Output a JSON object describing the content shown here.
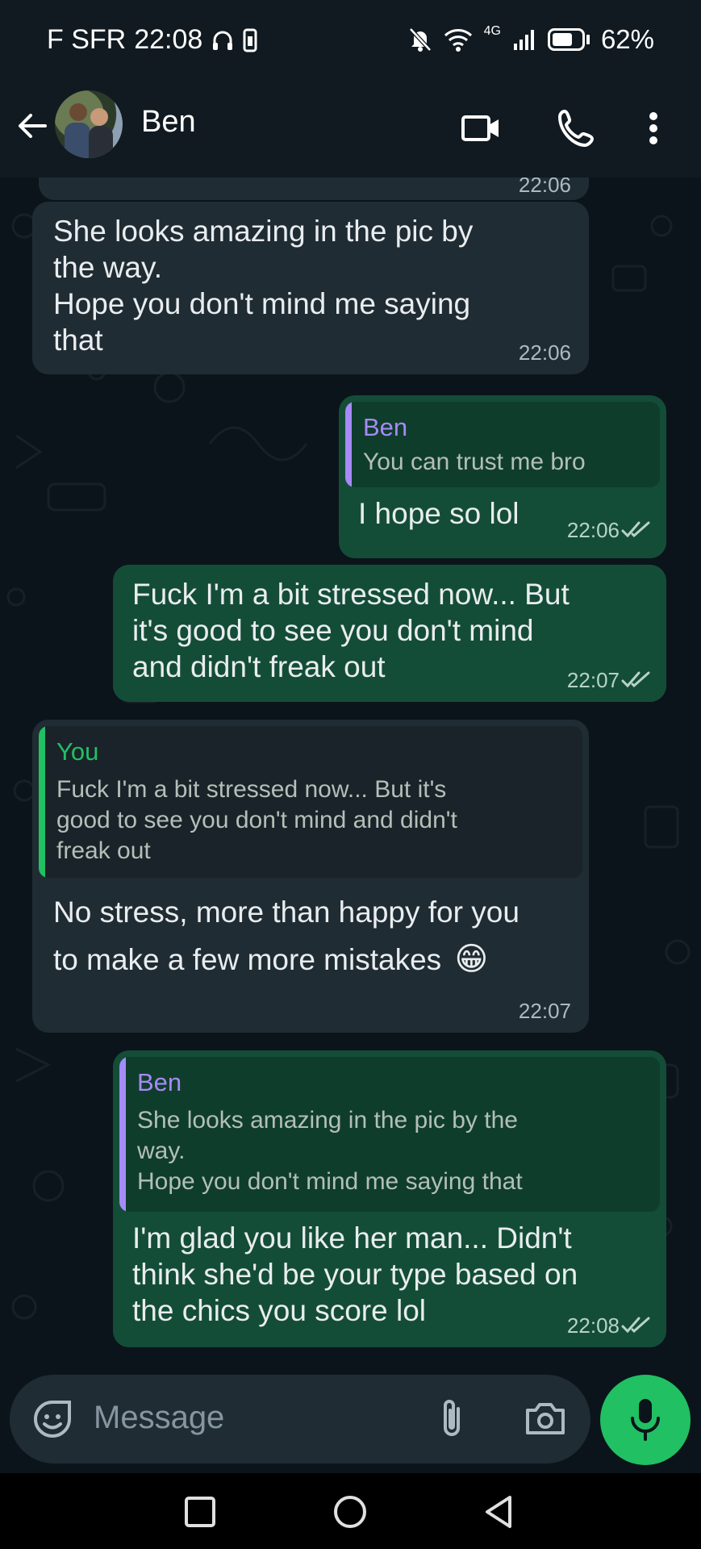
{
  "status_bar": {
    "carrier": "F SFR",
    "time": "22:08",
    "network": "4G",
    "battery": "62%"
  },
  "header": {
    "contact_name": "Ben"
  },
  "messages": [
    {
      "direction": "in",
      "lines": [
        "She looks amazing in the pic by",
        "the way.",
        "Hope you don't mind me saying",
        "that"
      ],
      "time": "22:06"
    },
    {
      "direction": "out",
      "quote_name": "Ben",
      "quote_lines": [
        "You can trust me bro"
      ],
      "lines": [
        "I hope so lol"
      ],
      "time": "22:06"
    },
    {
      "direction": "out",
      "lines": [
        "Fuck I'm a bit stressed now... But",
        "it's good to see you don't mind",
        "and didn't freak out"
      ],
      "time": "22:07"
    },
    {
      "direction": "in",
      "quote_name": "You",
      "quote_lines": [
        "Fuck I'm a bit stressed now... But it's",
        "good to see you don't mind and didn't",
        "freak out"
      ],
      "lines": [
        "No stress, more than happy for you",
        "to make a few more mistakes"
      ],
      "emoji": "😁",
      "time": "22:07"
    },
    {
      "direction": "out",
      "quote_name": "Ben",
      "quote_lines": [
        "She looks amazing in the pic by the",
        "way.",
        "Hope you don't mind me saying that"
      ],
      "lines": [
        "I'm glad you like her man... Didn't",
        "think she'd be your type based on",
        "the chics you score lol"
      ],
      "time": "22:08"
    }
  ],
  "scrolled_time_stub": "22:06",
  "input": {
    "placeholder": "Message"
  },
  "colors": {
    "incoming_bubble": "#202c33",
    "outgoing_bubble": "#144d37",
    "accent_green": "#21c063",
    "quote_bar_ben": "#a68af9",
    "quote_bar_you": "#21c063"
  }
}
